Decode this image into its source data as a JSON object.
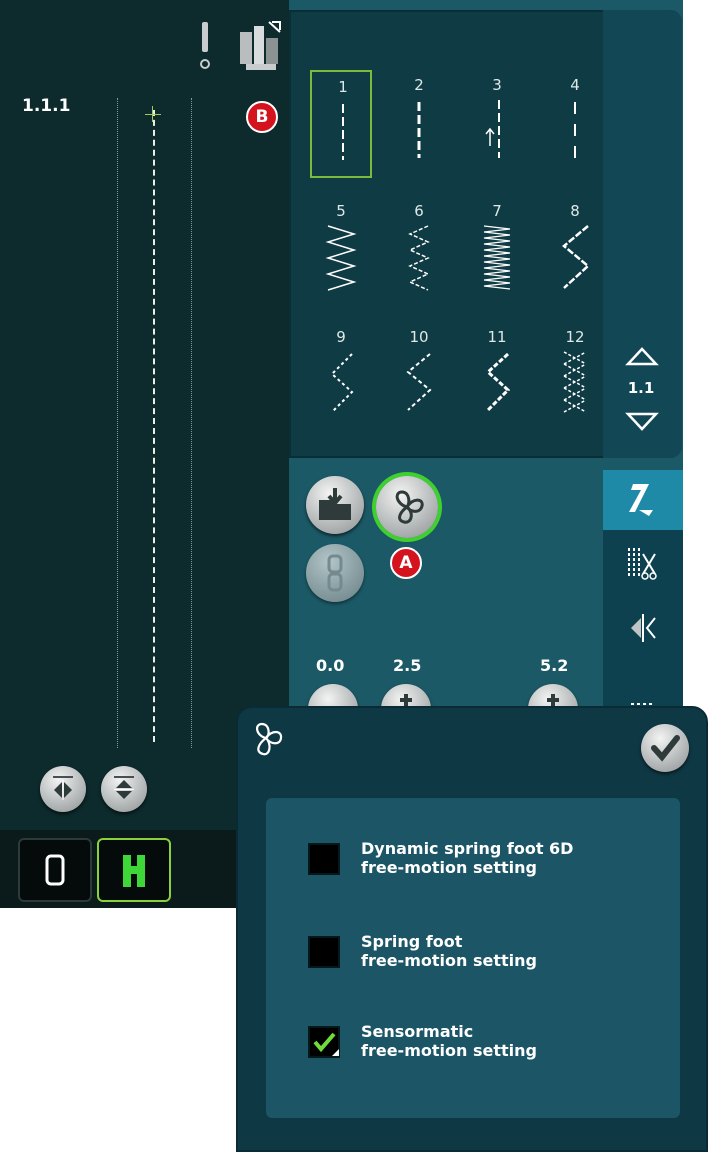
{
  "stitch_preview": {
    "stitch_number": "1.1.1",
    "status_icons": [
      "needle-warning-icon",
      "presser-foot-icon"
    ]
  },
  "callouts": {
    "a": "A",
    "b": "B"
  },
  "stitch_menu": {
    "stitches": [
      {
        "number": "1",
        "pattern": "straight",
        "selected": true
      },
      {
        "number": "2",
        "pattern": "triple-straight",
        "selected": false
      },
      {
        "number": "3",
        "pattern": "straight-left-arrow",
        "selected": false
      },
      {
        "number": "4",
        "pattern": "basting",
        "selected": false
      },
      {
        "number": "5",
        "pattern": "zigzag",
        "selected": false
      },
      {
        "number": "6",
        "pattern": "three-step-zigzag",
        "selected": false
      },
      {
        "number": "7",
        "pattern": "satin-zigzag",
        "selected": false
      },
      {
        "number": "8",
        "pattern": "wide-zigzag",
        "selected": false
      },
      {
        "number": "9",
        "pattern": "dotted-zigzag",
        "selected": false
      },
      {
        "number": "10",
        "pattern": "dotted-zigzag-2",
        "selected": false
      },
      {
        "number": "11",
        "pattern": "triple-zigzag",
        "selected": false
      },
      {
        "number": "12",
        "pattern": "honeycomb",
        "selected": false
      }
    ],
    "page": "1.1"
  },
  "settings": {
    "width": "0.0",
    "length": "2.5",
    "density": "5.2"
  },
  "dialog": {
    "options": [
      {
        "label": "Dynamic spring foot 6D\nfree-motion setting",
        "checked": false
      },
      {
        "label": "Spring foot\nfree-motion setting",
        "checked": false
      },
      {
        "label": "Sensormatic\nfree-motion setting",
        "checked": true
      }
    ]
  },
  "colors": {
    "panel_dark": "#0d2a2c",
    "accent_green": "#7dbb3a",
    "callout_red": "#d5131f",
    "tab_active": "#1e8aa7"
  }
}
